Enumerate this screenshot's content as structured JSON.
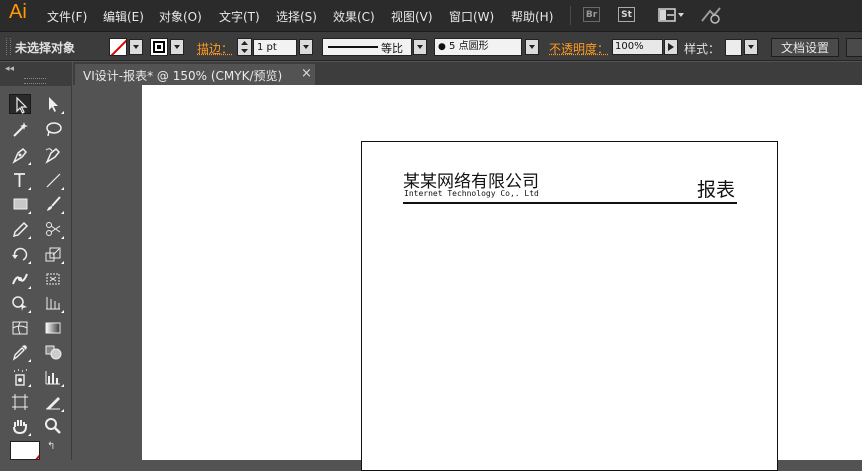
{
  "app": {
    "logo": "Ai"
  },
  "menu": {
    "items": [
      "文件(F)",
      "编辑(E)",
      "对象(O)",
      "文字(T)",
      "选择(S)",
      "效果(C)",
      "视图(V)",
      "窗口(W)",
      "帮助(H)"
    ],
    "bridge_label": "Br",
    "stock_label": "St"
  },
  "control": {
    "selection_status": "未选择对象",
    "stroke_label": "描边：",
    "stroke_weight": "1 pt",
    "stroke_profile": "等比",
    "brush_label": "5 点圆形",
    "opacity_label": "不透明度：",
    "opacity_value": "100%",
    "style_label": "样式：",
    "document_setup": "文档设置"
  },
  "tab": {
    "title": "VI设计-报表* @ 150% (CMYK/预览)",
    "close": "×"
  },
  "artboard": {
    "company_name": "某某网络有限公司",
    "company_english": "Internet Technology Co,. Ltd",
    "report_title": "报表"
  },
  "colors": {
    "accent": "#ff9a00",
    "menubar": "#2b2b2b",
    "controlbar": "#3c3c3c",
    "panel": "#535353"
  }
}
